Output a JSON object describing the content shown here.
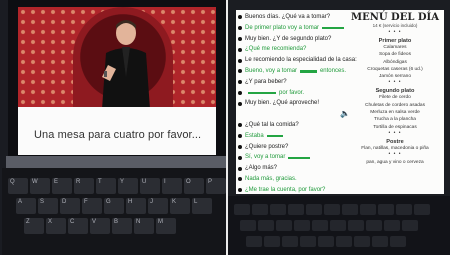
{
  "left_screen": {
    "subtitle": "Una mesa para cuatro por favor..."
  },
  "keyboard": {
    "row1": [
      "Q",
      "W",
      "E",
      "R",
      "T",
      "Y",
      "U",
      "I",
      "O",
      "P"
    ],
    "row2": [
      "A",
      "S",
      "D",
      "F",
      "G",
      "H",
      "J",
      "K",
      "L"
    ],
    "row3": [
      "Z",
      "X",
      "C",
      "V",
      "B",
      "N",
      "M"
    ]
  },
  "dialogue": [
    {
      "text": "Buenos días. ¿Qué va a tomar?",
      "green": false,
      "bullet": true,
      "blank": 0
    },
    {
      "text": "De primer plato voy a tomar",
      "green": true,
      "bullet": true,
      "blank": 22
    },
    {
      "text": "Muy bien. ¿Y de segundo plato?",
      "green": false,
      "bullet": true,
      "blank": 0
    },
    {
      "text": "¿Qué me recomienda?",
      "green": true,
      "bullet": true,
      "blank": 0
    },
    {
      "text": "Le recomiendo la especialidad de la casa:",
      "green": false,
      "bullet": true,
      "blank": 18
    },
    {
      "text": "Bueno, voy a tomar",
      "green": true,
      "bullet": true,
      "blank": 20,
      "tail": "entonces."
    },
    {
      "text": "¿Y para beber?",
      "green": false,
      "bullet": true,
      "blank": 0
    },
    {
      "text": "",
      "green": true,
      "bullet": true,
      "blank": 28,
      "tail": "por favor."
    },
    {
      "text": "Muy bien. ¿Qué aproveche!",
      "green": false,
      "bullet": true,
      "blank": 0
    },
    {
      "text": "",
      "green": false,
      "bullet": false,
      "blank": 0
    },
    {
      "text": "¿Qué tal la comida?",
      "green": false,
      "bullet": true,
      "blank": 0
    },
    {
      "text": "Estaba",
      "green": true,
      "bullet": true,
      "blank": 16
    },
    {
      "text": "¿Quiere postre?",
      "green": false,
      "bullet": true,
      "blank": 0
    },
    {
      "text": "Sí, voy a tomar",
      "green": true,
      "bullet": true,
      "blank": 22
    },
    {
      "text": "¿Algo más?",
      "green": false,
      "bullet": true,
      "blank": 0
    },
    {
      "text": "Nada más, gracias.",
      "green": true,
      "bullet": true,
      "blank": 0
    },
    {
      "text": "¿Me trae la cuenta, por favor?",
      "green": true,
      "bullet": true,
      "blank": 0
    }
  ],
  "menu": {
    "title": "MENÚ DEL DÍA",
    "subtitle": "14 € (servicio incluido)",
    "sep": "• • •",
    "first_heading": "Primer plato",
    "first_items": [
      "Calamares",
      "Sopa de fideos",
      "Albóndigas",
      "Croquetas caseras (6 ud.)",
      "Jamón serrano"
    ],
    "second_heading": "Segundo plato",
    "second_items": [
      "Filete de cerdo",
      "Chuletas de cordero asadas",
      "Merluza en salsa verde",
      "Trucha a la plancha",
      "Tortilla de espinacas"
    ],
    "dessert_heading": "Postre",
    "dessert_items": [
      "Flan, natillas, macedonia o piña"
    ],
    "bottom": "pan, agua y vino o cerveza"
  },
  "colors": {
    "green": "#1f9a3a",
    "stage_red": "#b0252a"
  },
  "icons": {
    "speaker": "speaker-icon"
  }
}
